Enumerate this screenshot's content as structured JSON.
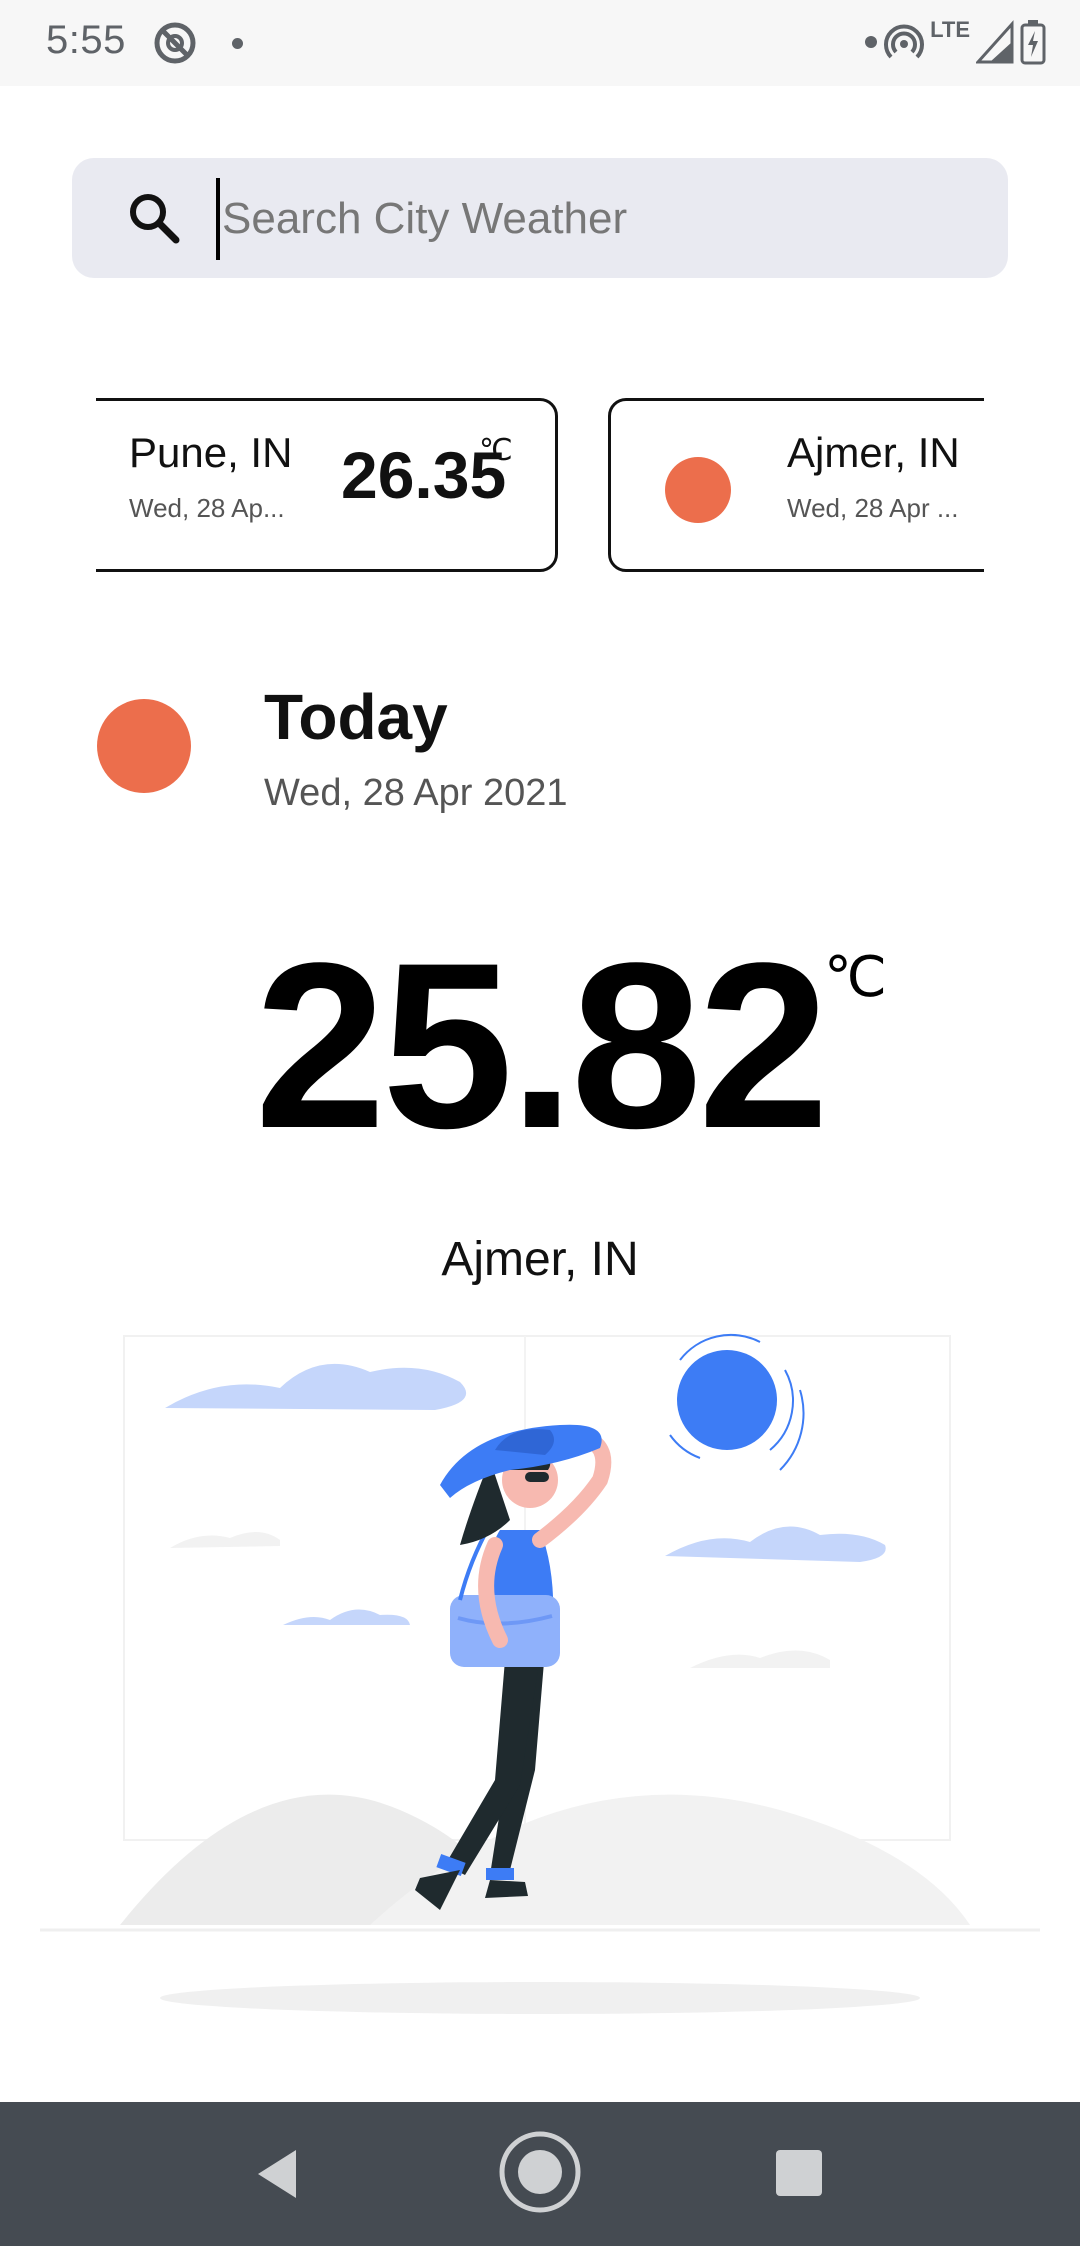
{
  "status_bar": {
    "time": "5:55",
    "network_label": "LTE"
  },
  "search": {
    "placeholder": "Search City Weather",
    "value": ""
  },
  "cities": [
    {
      "city": "Pune, IN",
      "date": "Wed, 28 Ap...",
      "temp": "26.35",
      "unit": "℃"
    },
    {
      "city": "Ajmer, IN",
      "date": "Wed, 28 Apr ..."
    }
  ],
  "today": {
    "label": "Today",
    "date": "Wed, 28 Apr 2021",
    "temperature": "25.82",
    "unit": "℃",
    "city": "Ajmer, IN"
  },
  "colors": {
    "sun": "#ec6e4c",
    "search_bg": "#e9eaf1",
    "accent_blue": "#3d7cf5",
    "nav_bar": "#454b52"
  },
  "icons": {
    "search": "search-icon",
    "back": "back-triangle-icon",
    "home": "home-circle-icon",
    "recents": "recents-square-icon"
  }
}
